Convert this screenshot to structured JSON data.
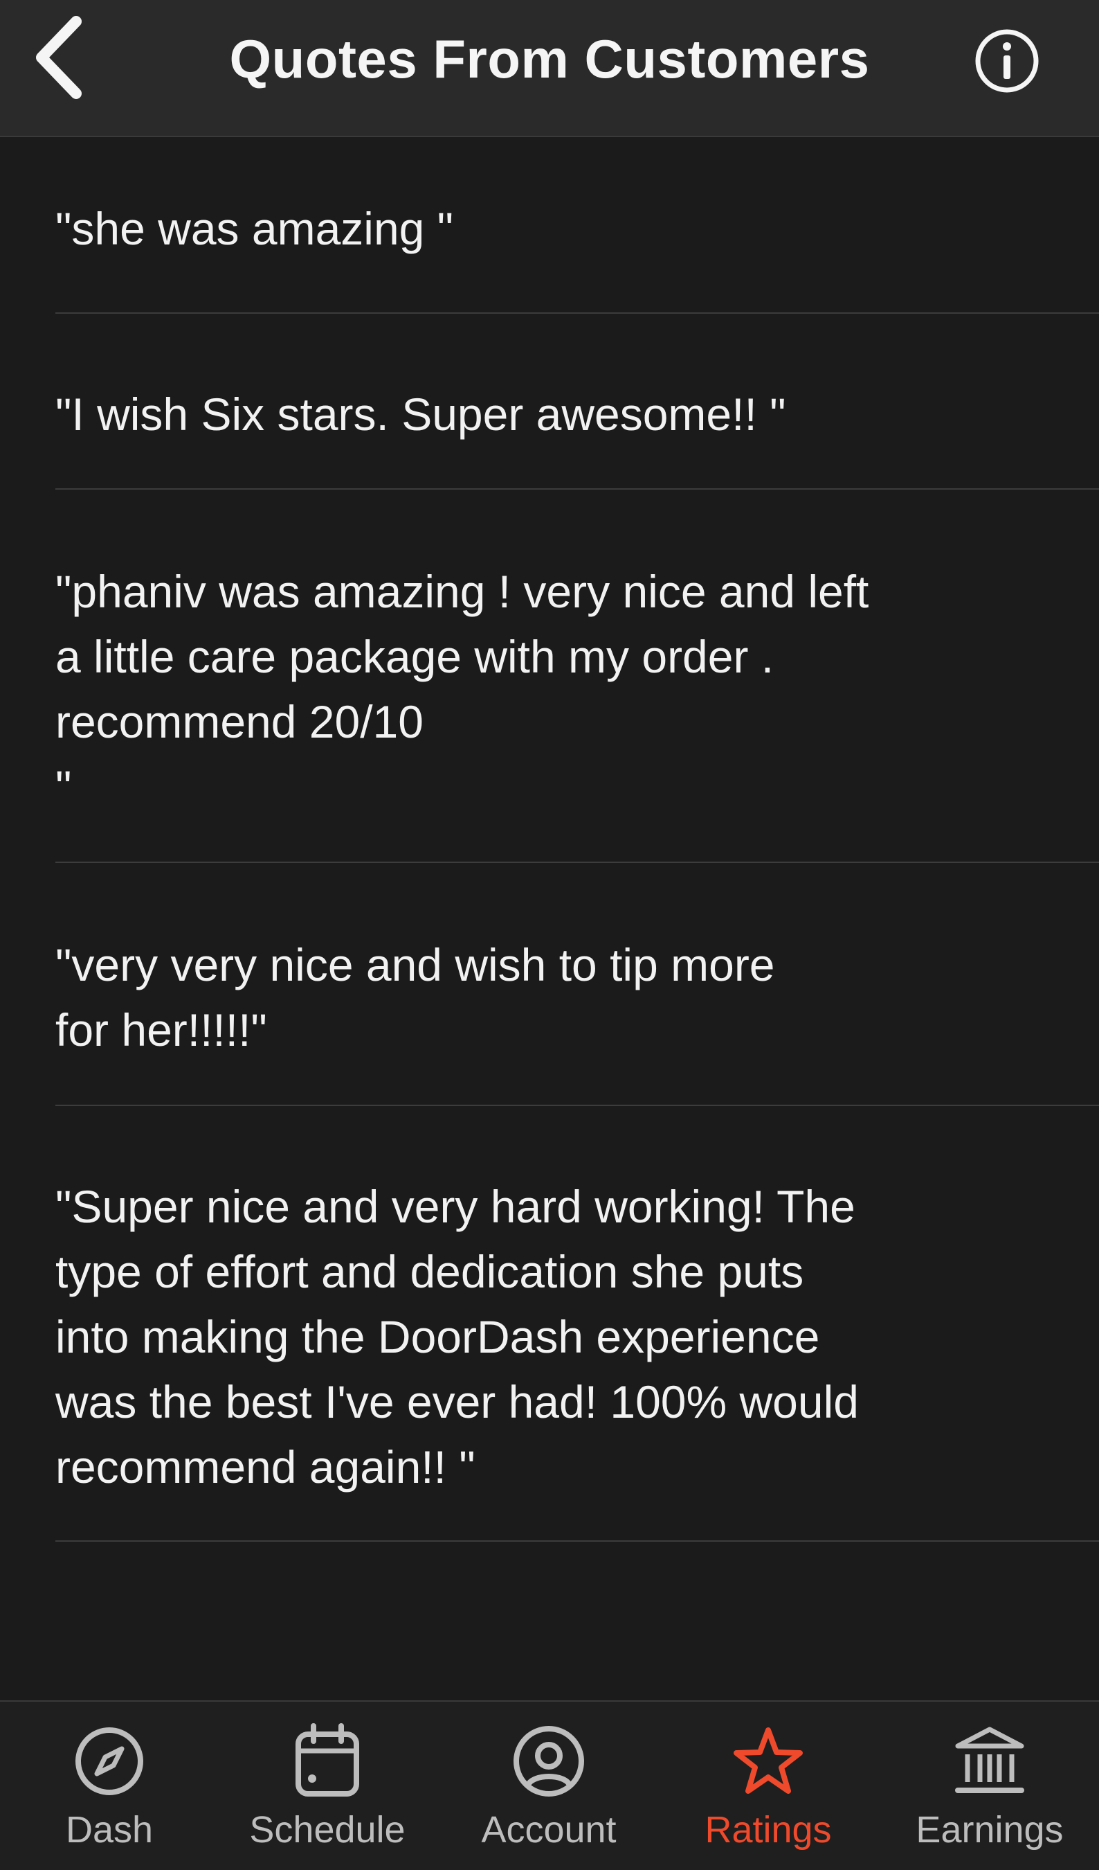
{
  "header": {
    "title": "Quotes From Customers",
    "back_icon": "chevron-left-icon",
    "info_icon": "info-icon"
  },
  "quotes": [
    "\"she was amazing \"",
    "\"I wish Six stars. Super awesome!! \"",
    "\"phaniv was amazing ! very nice and left\na little care package with my order .\nrecommend 20/10\n\"",
    "\"very very nice and wish to tip more\nfor her!!!!!\"",
    "\"Super nice and very hard working! The\ntype of effort and dedication she puts\ninto making the DoorDash experience\nwas the best I've ever had! 100% would\nrecommend again!! \""
  ],
  "nav": {
    "items": [
      {
        "label": "Dash",
        "icon": "compass-icon"
      },
      {
        "label": "Schedule",
        "icon": "calendar-icon"
      },
      {
        "label": "Account",
        "icon": "user-circle-icon"
      },
      {
        "label": "Ratings",
        "icon": "star-icon"
      },
      {
        "label": "Earnings",
        "icon": "bank-icon"
      }
    ],
    "active": "Ratings"
  },
  "colors": {
    "background": "#1b1b1b",
    "header_bg": "#2a2a2a",
    "accent": "#ef4a2c",
    "inactive_icon": "#bdbdbd",
    "text": "#f2f2f2"
  }
}
